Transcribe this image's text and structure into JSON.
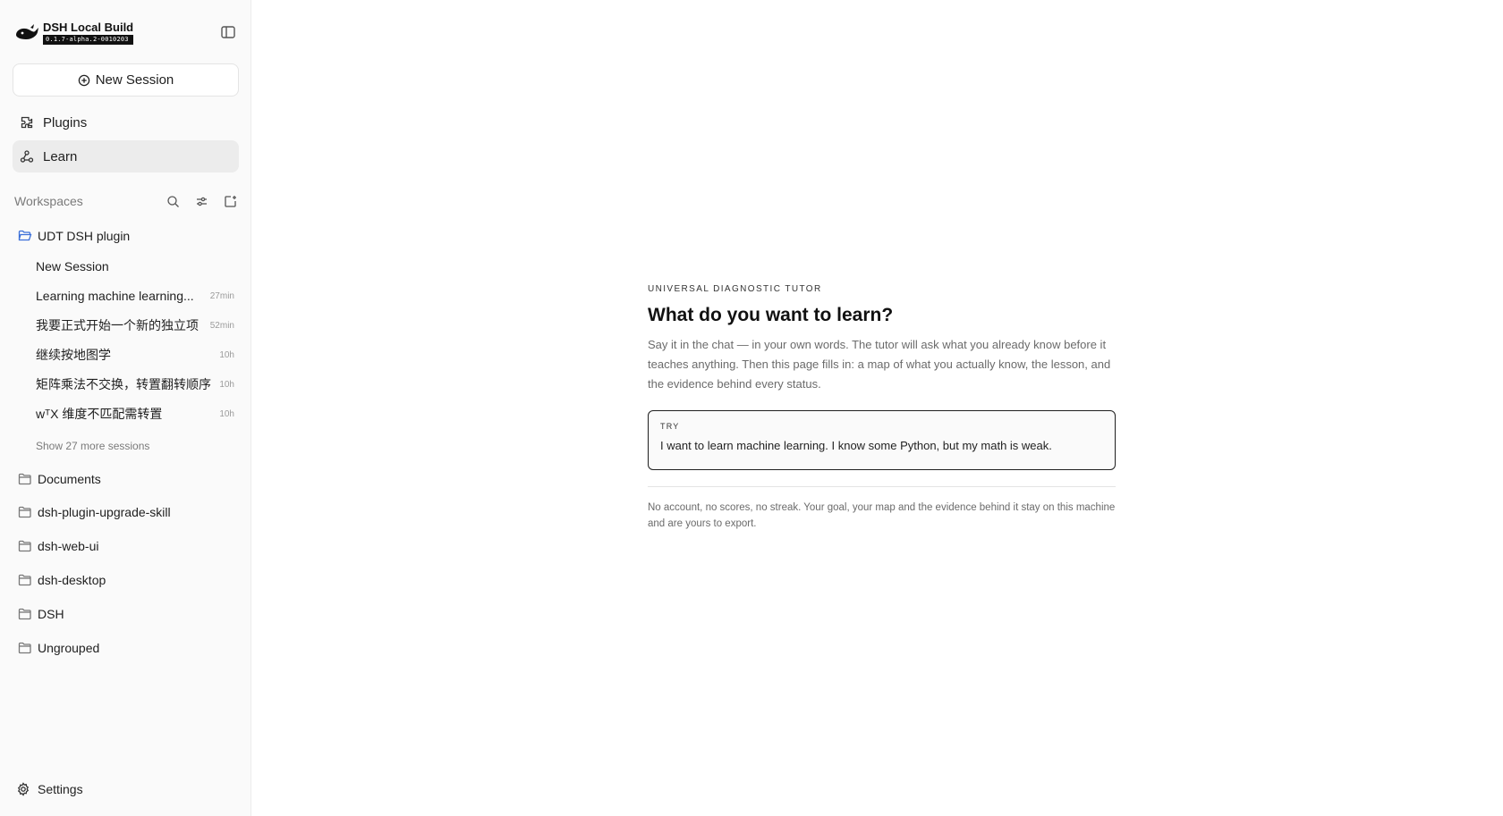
{
  "app": {
    "name": "DSH Local Build",
    "version": "0.1.7-alpha.2-0010203"
  },
  "sidebar": {
    "new_session_label": "New Session",
    "nav": [
      {
        "label": "Plugins",
        "icon": "puzzle-icon"
      },
      {
        "label": "Learn",
        "icon": "graph-icon",
        "active": true
      }
    ],
    "workspaces_title": "Workspaces",
    "workspaces": [
      {
        "name": "UDT DSH plugin",
        "expanded": true,
        "sessions": [
          {
            "title": "New Session",
            "time": ""
          },
          {
            "title": "Learning machine learning...",
            "time": "27min"
          },
          {
            "title": "我要正式开始一个新的独立项",
            "time": "52min"
          },
          {
            "title": "继续按地图学",
            "time": "10h"
          },
          {
            "title": "矩阵乘法不交换，转置翻转顺序",
            "time": "10h"
          },
          {
            "title": "wᵀX 维度不匹配需转置",
            "time": "10h"
          }
        ],
        "show_more": "Show 27 more sessions"
      },
      {
        "name": "Documents"
      },
      {
        "name": "dsh-plugin-upgrade-skill"
      },
      {
        "name": "dsh-web-ui"
      },
      {
        "name": "dsh-desktop"
      },
      {
        "name": "DSH"
      },
      {
        "name": "Ungrouped"
      }
    ],
    "settings_label": "Settings"
  },
  "main": {
    "eyebrow": "UNIVERSAL DIAGNOSTIC TUTOR",
    "heading": "What do you want to learn?",
    "description": "Say it in the chat — in your own words. The tutor will ask what you already know before it teaches anything. Then this page fills in: a map of what you actually know, the lesson, and the evidence behind every status.",
    "try_label": "TRY",
    "try_text": "I want to learn machine learning. I know some Python, but my math is weak.",
    "footnote": "No account, no scores, no streak. Your goal, your map and the evidence behind it stay on this machine and are yours to export."
  },
  "colors": {
    "accent_folder": "#3b6fd8",
    "active_bg": "#ececec",
    "text": "#1f1f1f",
    "muted": "#7a7a7a"
  }
}
